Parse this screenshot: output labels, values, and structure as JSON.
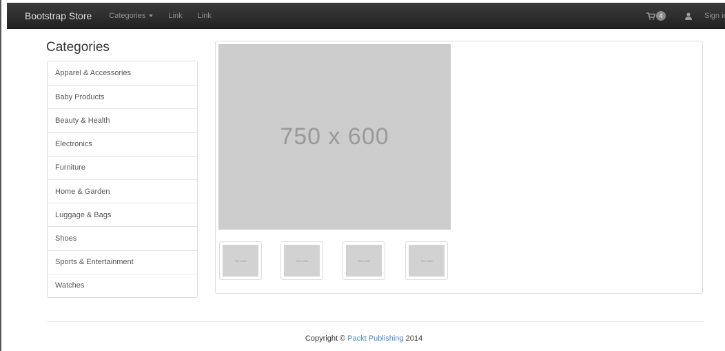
{
  "navbar": {
    "brand": "Bootstrap Store",
    "links": [
      {
        "label": "Categories",
        "dropdown": true
      },
      {
        "label": "Link"
      },
      {
        "label": "Link"
      }
    ],
    "cart_icon": "shopping-cart-icon",
    "cart_count": "4",
    "user_icon": "user-icon",
    "signin_label": "Sign in"
  },
  "sidebar": {
    "title": "Categories",
    "items": [
      "Apparel & Accessories",
      "Baby Products",
      "Beauty & Health",
      "Electronics",
      "Furniture",
      "Home & Garden",
      "Luggage & Bags",
      "Shoes",
      "Sports & Entertainment",
      "Watches"
    ]
  },
  "product": {
    "main_image_label": "750 x 600",
    "thumbnails": [
      "750 x 600",
      "750 x 600",
      "750 x 600",
      "750 x 600"
    ]
  },
  "footer": {
    "prefix": "Copyright © ",
    "link": "Packt Publishing",
    "suffix": " 2014"
  },
  "colors": {
    "navbar_bg": "#222222",
    "placeholder_bg": "#cccccc",
    "link_blue": "#428bca"
  }
}
